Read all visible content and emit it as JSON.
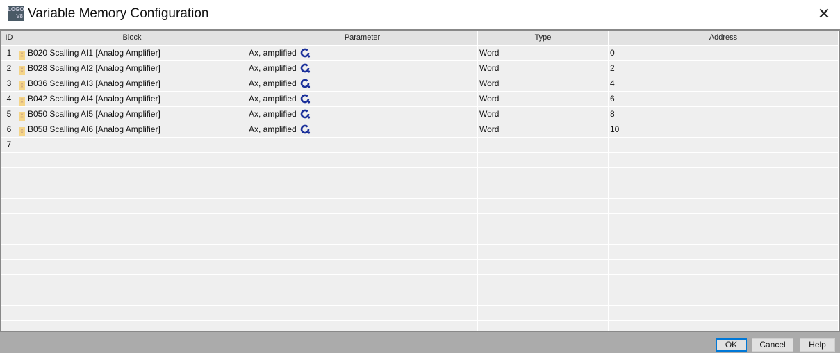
{
  "window": {
    "title": "Variable Memory Configuration",
    "logo_text": "LOGO V8"
  },
  "table": {
    "headers": {
      "id": "ID",
      "block": "Block",
      "parameter": "Parameter",
      "type": "Type",
      "address": "Address"
    },
    "rows": [
      {
        "id": "1",
        "block": "B020 Scalling AI1 [Analog Amplifier]",
        "parameter": "Ax, amplified",
        "type": "Word",
        "address": "0"
      },
      {
        "id": "2",
        "block": "B028 Scalling AI2 [Analog Amplifier]",
        "parameter": "Ax, amplified",
        "type": "Word",
        "address": "2"
      },
      {
        "id": "3",
        "block": "B036 Scalling AI3 [Analog Amplifier]",
        "parameter": "Ax, amplified",
        "type": "Word",
        "address": "4"
      },
      {
        "id": "4",
        "block": "B042 Scalling AI4 [Analog Amplifier]",
        "parameter": "Ax, amplified",
        "type": "Word",
        "address": "6"
      },
      {
        "id": "5",
        "block": "B050 Scalling AI5 [Analog Amplifier]",
        "parameter": "Ax, amplified",
        "type": "Word",
        "address": "8"
      },
      {
        "id": "6",
        "block": "B058 Scalling AI6 [Analog Amplifier]",
        "parameter": "Ax, amplified",
        "type": "Word",
        "address": "10"
      }
    ],
    "new_row_id": "7"
  },
  "buttons": {
    "ok": "OK",
    "cancel": "Cancel",
    "help": "Help"
  }
}
